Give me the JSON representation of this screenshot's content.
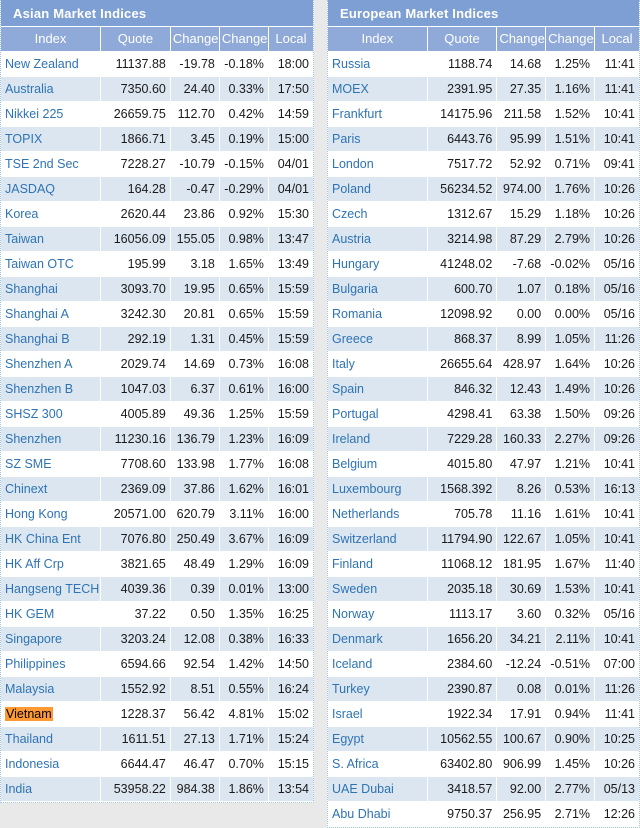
{
  "columns": [
    "Index",
    "Quote",
    "Change",
    "Change%",
    "Local"
  ],
  "colors": {
    "title_bar": "#7e9fd4",
    "header_row": "#8fa9d8",
    "row_alt": "#dce6f1",
    "index_link": "#2e74b5",
    "positive": "#13703f",
    "negative": "#ff3300",
    "highlight": "#ff9933"
  },
  "panels": [
    {
      "id": "asian",
      "title": "Asian Market Indices",
      "rows": [
        {
          "name": "New Zealand",
          "quote": "11137.88",
          "change": "-19.78",
          "changep": "-0.18%",
          "local": "18:00",
          "dir": "down"
        },
        {
          "name": "Australia",
          "quote": "7350.60",
          "change": "24.40",
          "changep": "0.33%",
          "local": "17:50",
          "dir": "up"
        },
        {
          "name": "Nikkei 225",
          "quote": "26659.75",
          "change": "112.70",
          "changep": "0.42%",
          "local": "14:59",
          "dir": "up"
        },
        {
          "name": "TOPIX",
          "quote": "1866.71",
          "change": "3.45",
          "changep": "0.19%",
          "local": "15:00",
          "dir": "up"
        },
        {
          "name": "TSE 2nd Sec",
          "quote": "7228.27",
          "change": "-10.79",
          "changep": "-0.15%",
          "local": "04/01",
          "dir": "down"
        },
        {
          "name": "JASDAQ",
          "quote": "164.28",
          "change": "-0.47",
          "changep": "-0.29%",
          "local": "04/01",
          "dir": "down"
        },
        {
          "name": "Korea",
          "quote": "2620.44",
          "change": "23.86",
          "changep": "0.92%",
          "local": "15:30",
          "dir": "up"
        },
        {
          "name": "Taiwan",
          "quote": "16056.09",
          "change": "155.05",
          "changep": "0.98%",
          "local": "13:47",
          "dir": "up"
        },
        {
          "name": "Taiwan OTC",
          "quote": "195.99",
          "change": "3.18",
          "changep": "1.65%",
          "local": "13:49",
          "dir": "up"
        },
        {
          "name": "Shanghai",
          "quote": "3093.70",
          "change": "19.95",
          "changep": "0.65%",
          "local": "15:59",
          "dir": "up"
        },
        {
          "name": "Shanghai A",
          "quote": "3242.30",
          "change": "20.81",
          "changep": "0.65%",
          "local": "15:59",
          "dir": "up"
        },
        {
          "name": "Shanghai B",
          "quote": "292.19",
          "change": "1.31",
          "changep": "0.45%",
          "local": "15:59",
          "dir": "up"
        },
        {
          "name": "Shenzhen A",
          "quote": "2029.74",
          "change": "14.69",
          "changep": "0.73%",
          "local": "16:08",
          "dir": "up"
        },
        {
          "name": "Shenzhen B",
          "quote": "1047.03",
          "change": "6.37",
          "changep": "0.61%",
          "local": "16:00",
          "dir": "up"
        },
        {
          "name": "SHSZ 300",
          "quote": "4005.89",
          "change": "49.36",
          "changep": "1.25%",
          "local": "15:59",
          "dir": "up"
        },
        {
          "name": "Shenzhen",
          "quote": "11230.16",
          "change": "136.79",
          "changep": "1.23%",
          "local": "16:09",
          "dir": "up"
        },
        {
          "name": "SZ SME",
          "quote": "7708.60",
          "change": "133.98",
          "changep": "1.77%",
          "local": "16:08",
          "dir": "up"
        },
        {
          "name": "Chinext",
          "quote": "2369.09",
          "change": "37.86",
          "changep": "1.62%",
          "local": "16:01",
          "dir": "up"
        },
        {
          "name": "Hong Kong",
          "quote": "20571.00",
          "change": "620.79",
          "changep": "3.11%",
          "local": "16:00",
          "dir": "up"
        },
        {
          "name": "HK China Ent",
          "quote": "7076.80",
          "change": "250.49",
          "changep": "3.67%",
          "local": "16:09",
          "dir": "up"
        },
        {
          "name": "HK Aff Crp",
          "quote": "3821.65",
          "change": "48.49",
          "changep": "1.29%",
          "local": "16:09",
          "dir": "up"
        },
        {
          "name": "Hangseng TECH",
          "quote": "4039.36",
          "change": "0.39",
          "changep": "0.01%",
          "local": "13:00",
          "dir": "up"
        },
        {
          "name": "HK GEM",
          "quote": "37.22",
          "change": "0.50",
          "changep": "1.35%",
          "local": "16:25",
          "dir": "up"
        },
        {
          "name": "Singapore",
          "quote": "3203.24",
          "change": "12.08",
          "changep": "0.38%",
          "local": "16:33",
          "dir": "up"
        },
        {
          "name": "Philippines",
          "quote": "6594.66",
          "change": "92.54",
          "changep": "1.42%",
          "local": "14:50",
          "dir": "up"
        },
        {
          "name": "Malaysia",
          "quote": "1552.92",
          "change": "8.51",
          "changep": "0.55%",
          "local": "16:24",
          "dir": "up"
        },
        {
          "name": "Vietnam",
          "quote": "1228.37",
          "change": "56.42",
          "changep": "4.81%",
          "local": "15:02",
          "dir": "up",
          "highlight": true
        },
        {
          "name": "Thailand",
          "quote": "1611.51",
          "change": "27.13",
          "changep": "1.71%",
          "local": "15:24",
          "dir": "up"
        },
        {
          "name": "Indonesia",
          "quote": "6644.47",
          "change": "46.47",
          "changep": "0.70%",
          "local": "15:15",
          "dir": "up"
        },
        {
          "name": "India",
          "quote": "53958.22",
          "change": "984.38",
          "changep": "1.86%",
          "local": "13:54",
          "dir": "up"
        }
      ]
    },
    {
      "id": "european",
      "title": "European Market Indices",
      "rows": [
        {
          "name": "Russia",
          "quote": "1188.74",
          "change": "14.68",
          "changep": "1.25%",
          "local": "11:41",
          "dir": "up"
        },
        {
          "name": "MOEX",
          "quote": "2391.95",
          "change": "27.35",
          "changep": "1.16%",
          "local": "11:41",
          "dir": "up"
        },
        {
          "name": "Frankfurt",
          "quote": "14175.96",
          "change": "211.58",
          "changep": "1.52%",
          "local": "10:41",
          "dir": "up"
        },
        {
          "name": "Paris",
          "quote": "6443.76",
          "change": "95.99",
          "changep": "1.51%",
          "local": "10:41",
          "dir": "up"
        },
        {
          "name": "London",
          "quote": "7517.72",
          "change": "52.92",
          "changep": "0.71%",
          "local": "09:41",
          "dir": "up"
        },
        {
          "name": "Poland",
          "quote": "56234.52",
          "change": "974.00",
          "changep": "1.76%",
          "local": "10:26",
          "dir": "up"
        },
        {
          "name": "Czech",
          "quote": "1312.67",
          "change": "15.29",
          "changep": "1.18%",
          "local": "10:26",
          "dir": "up"
        },
        {
          "name": "Austria",
          "quote": "3214.98",
          "change": "87.29",
          "changep": "2.79%",
          "local": "10:26",
          "dir": "up"
        },
        {
          "name": "Hungary",
          "quote": "41248.02",
          "change": "-7.68",
          "changep": "-0.02%",
          "local": "05/16",
          "dir": "down"
        },
        {
          "name": "Bulgaria",
          "quote": "600.70",
          "change": "1.07",
          "changep": "0.18%",
          "local": "05/16",
          "dir": "up"
        },
        {
          "name": "Romania",
          "quote": "12098.92",
          "change": "0.00",
          "changep": "0.00%",
          "local": "05/16",
          "dir": "flat"
        },
        {
          "name": "Greece",
          "quote": "868.37",
          "change": "8.99",
          "changep": "1.05%",
          "local": "11:26",
          "dir": "up"
        },
        {
          "name": "Italy",
          "quote": "26655.64",
          "change": "428.97",
          "changep": "1.64%",
          "local": "10:26",
          "dir": "up"
        },
        {
          "name": "Spain",
          "quote": "846.32",
          "change": "12.43",
          "changep": "1.49%",
          "local": "10:26",
          "dir": "up"
        },
        {
          "name": "Portugal",
          "quote": "4298.41",
          "change": "63.38",
          "changep": "1.50%",
          "local": "09:26",
          "dir": "up"
        },
        {
          "name": "Ireland",
          "quote": "7229.28",
          "change": "160.33",
          "changep": "2.27%",
          "local": "09:26",
          "dir": "up"
        },
        {
          "name": "Belgium",
          "quote": "4015.80",
          "change": "47.97",
          "changep": "1.21%",
          "local": "10:41",
          "dir": "up"
        },
        {
          "name": "Luxembourg",
          "quote": "1568.392",
          "change": "8.26",
          "changep": "0.53%",
          "local": "16:13",
          "dir": "up"
        },
        {
          "name": "Netherlands",
          "quote": "705.78",
          "change": "11.16",
          "changep": "1.61%",
          "local": "10:41",
          "dir": "up"
        },
        {
          "name": "Switzerland",
          "quote": "11794.90",
          "change": "122.67",
          "changep": "1.05%",
          "local": "10:41",
          "dir": "up"
        },
        {
          "name": "Finland",
          "quote": "11068.12",
          "change": "181.95",
          "changep": "1.67%",
          "local": "11:40",
          "dir": "up"
        },
        {
          "name": "Sweden",
          "quote": "2035.18",
          "change": "30.69",
          "changep": "1.53%",
          "local": "10:41",
          "dir": "up"
        },
        {
          "name": "Norway",
          "quote": "1113.17",
          "change": "3.60",
          "changep": "0.32%",
          "local": "05/16",
          "dir": "up"
        },
        {
          "name": "Denmark",
          "quote": "1656.20",
          "change": "34.21",
          "changep": "2.11%",
          "local": "10:41",
          "dir": "up"
        },
        {
          "name": "Iceland",
          "quote": "2384.60",
          "change": "-12.24",
          "changep": "-0.51%",
          "local": "07:00",
          "dir": "down"
        },
        {
          "name": "Turkey",
          "quote": "2390.87",
          "change": "0.08",
          "changep": "0.01%",
          "local": "11:26",
          "dir": "up"
        },
        {
          "name": "Israel",
          "quote": "1922.34",
          "change": "17.91",
          "changep": "0.94%",
          "local": "11:41",
          "dir": "up"
        },
        {
          "name": "Egypt",
          "quote": "10562.55",
          "change": "100.67",
          "changep": "0.90%",
          "local": "10:25",
          "dir": "up"
        },
        {
          "name": "S. Africa",
          "quote": "63402.80",
          "change": "906.99",
          "changep": "1.45%",
          "local": "10:26",
          "dir": "up"
        },
        {
          "name": "UAE Dubai",
          "quote": "3418.57",
          "change": "92.00",
          "changep": "2.77%",
          "local": "05/13",
          "dir": "up"
        },
        {
          "name": "Abu Dhabi",
          "quote": "9750.37",
          "change": "256.95",
          "changep": "2.71%",
          "local": "12:26",
          "dir": "up"
        }
      ]
    }
  ]
}
